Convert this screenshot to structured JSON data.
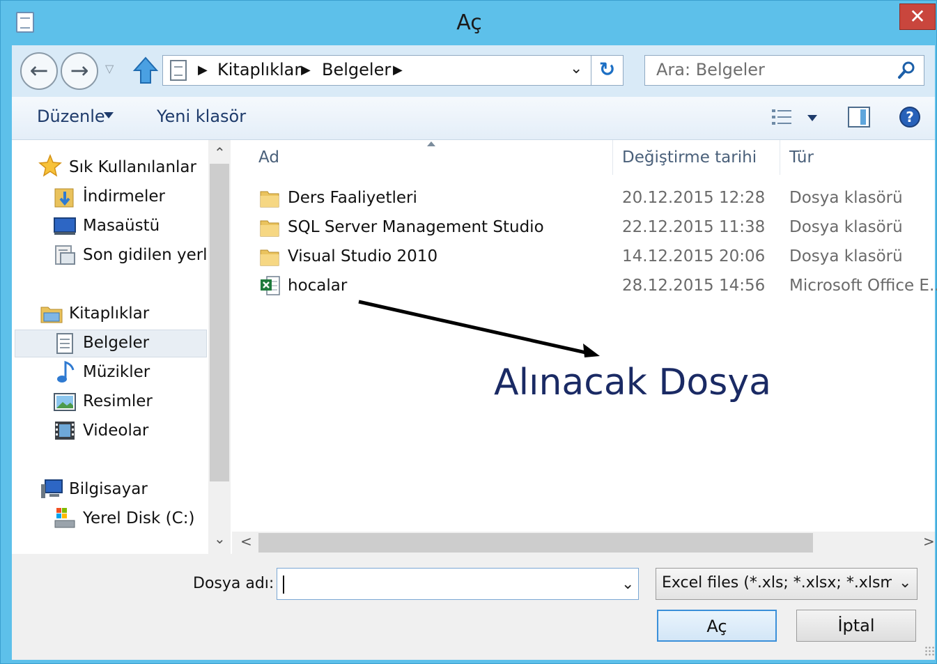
{
  "window": {
    "title": "Aç",
    "close_label": "✕"
  },
  "navbar": {
    "back": "←",
    "forward": "→",
    "recent_caret": "▽",
    "breadcrumbs": [
      "Kitaplıklar",
      "Belgeler"
    ],
    "crumb_sep": "▶",
    "address_dropdown": "⌄",
    "refresh": "↻",
    "search_placeholder": "Ara: Belgeler"
  },
  "toolbar": {
    "organize": "Düzenle",
    "new_folder": "Yeni klasör",
    "help": "?"
  },
  "navpane": {
    "favorites": {
      "label": "Sık Kullanılanlar",
      "items": [
        "İndirmeler",
        "Masaüstü",
        "Son gidilen yerler"
      ]
    },
    "libraries": {
      "label": "Kitaplıklar",
      "items": [
        "Belgeler",
        "Müzikler",
        "Resimler",
        "Videolar"
      ]
    },
    "computer": {
      "label": "Bilgisayar",
      "items": [
        "Yerel Disk (C:)"
      ]
    },
    "scroll_up": "⌃",
    "scroll_down": "⌄"
  },
  "filelist": {
    "columns": [
      "Ad",
      "Değiştirme tarihi",
      "Tür"
    ],
    "rows": [
      {
        "name": "Ders Faaliyetleri",
        "date": "20.12.2015 12:28",
        "type": "Dosya klasörü",
        "icon": "folder-icon"
      },
      {
        "name": "SQL Server Management Studio",
        "date": "22.12.2015 11:38",
        "type": "Dosya klasörü",
        "icon": "folder-icon"
      },
      {
        "name": "Visual Studio 2010",
        "date": "14.12.2015 20:06",
        "type": "Dosya klasörü",
        "icon": "folder-icon"
      },
      {
        "name": "hocalar",
        "date": "28.12.2015 14:56",
        "type": "Microsoft Office E...",
        "icon": "excel-icon"
      }
    ],
    "scroll_left": "<",
    "scroll_right": ">"
  },
  "annotation": {
    "text": "Alınacak Dosya"
  },
  "bottom": {
    "filename_label": "Dosya adı:",
    "filename_value": "",
    "filename_dropdown": "⌄",
    "filetype": "Excel files (*.xls; *.xlsx; *.xlsm; *.xlsb)",
    "filetype_dropdown": "⌄",
    "open_button": "Aç",
    "cancel_button": "İptal"
  },
  "colors": {
    "titlebar": "#5dc0ea",
    "close": "#c9463d",
    "accent": "#1c6fc4",
    "annotation": "#1a2a64"
  }
}
